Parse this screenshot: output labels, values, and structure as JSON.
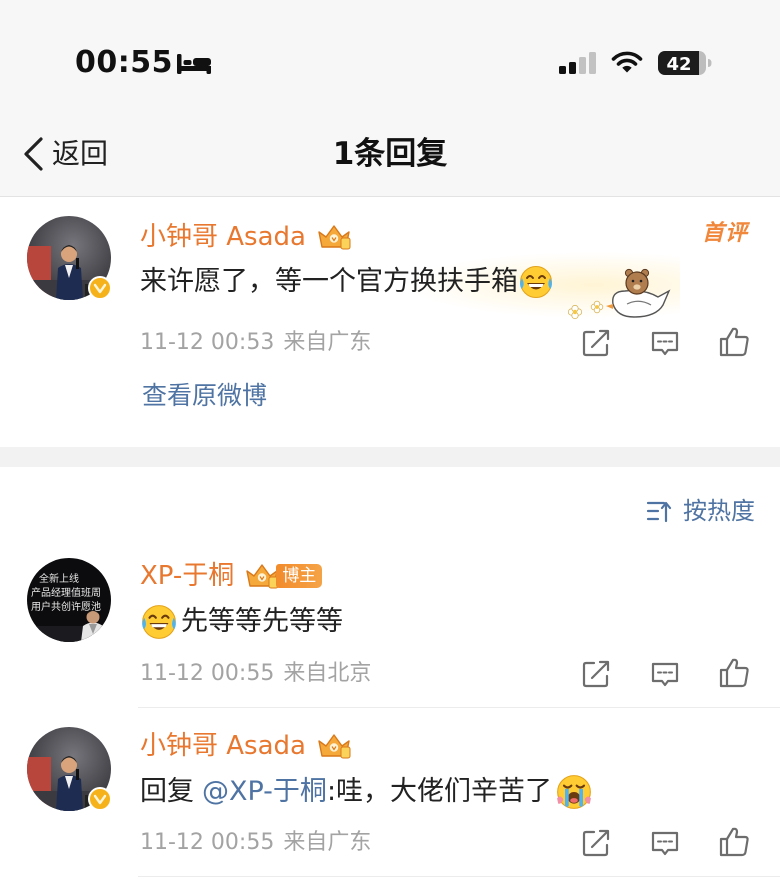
{
  "status_bar": {
    "time": "00:55",
    "battery_level": "42",
    "icons": [
      "bed-icon",
      "signal-icon",
      "wifi-icon",
      "battery-icon"
    ]
  },
  "nav": {
    "back_label": "返回",
    "back_icon": "chevron-left-icon",
    "title": "1条回复"
  },
  "root_comment": {
    "author": "小钟哥 Asada",
    "verified": true,
    "member_icon": "crown-badge-icon",
    "badge": "首评",
    "text": "来许愿了，等一个官方换扶手箱",
    "emoji": "laughing-tears-emoji",
    "decoration": "duck-bear-sticker",
    "time": "11-12 00:53",
    "source": "来自广东",
    "actions": [
      "share-icon",
      "comment-icon",
      "like-icon"
    ],
    "view_original": "查看原微博"
  },
  "sort": {
    "label": "按热度",
    "icon": "sort-icon"
  },
  "replies": [
    {
      "author": "XP-于桐",
      "member_icon": "crown-badge-icon",
      "role_tag": "博主",
      "emoji": "laughing-tears-emoji",
      "text": "先等等先等等",
      "time": "11-12 00:55",
      "source": "来自北京",
      "avatar_text": [
        "全新上线",
        "产品经理值班周",
        "用户共创许愿池"
      ],
      "actions": [
        "share-icon",
        "comment-icon",
        "like-icon"
      ]
    },
    {
      "author": "小钟哥 Asada",
      "verified": true,
      "member_icon": "crown-badge-icon",
      "reply_prefix": "回复",
      "mention": "@XP-于桐",
      "text": ":哇，大佬们辛苦了",
      "emoji": "loudly-crying-emoji",
      "time": "11-12 00:55",
      "source": "来自广东",
      "actions": [
        "share-icon",
        "comment-icon",
        "like-icon"
      ]
    }
  ],
  "colors": {
    "name_orange": "#e8782f",
    "link_blue": "#4f74a3",
    "meta_gray": "#a3a3a3",
    "verified_yellow": "#f6b21b",
    "page_gray": "#f2f2f2",
    "header_gray": "#f7f7f7"
  }
}
